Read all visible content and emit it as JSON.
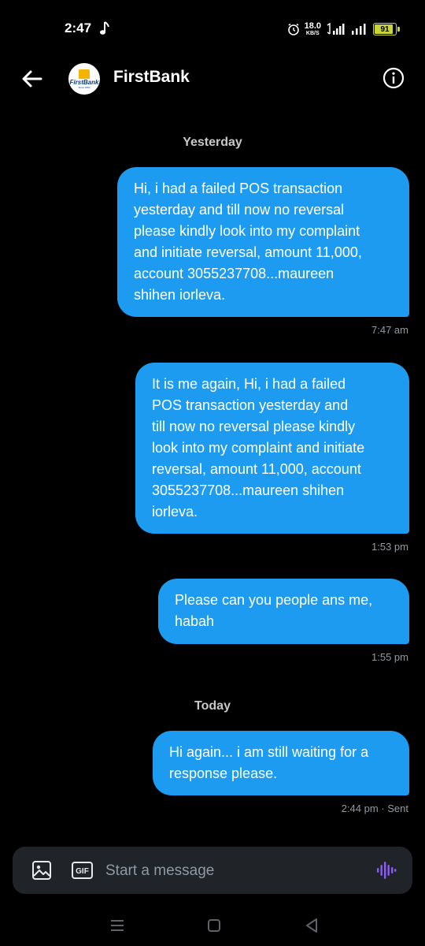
{
  "status_bar": {
    "time": "2:47",
    "network_speed": "18.0",
    "network_unit": "KB/S",
    "battery": "91",
    "battery_level": 0.91,
    "icons": [
      "music-note-icon",
      "alarm-icon",
      "hd-signal-icon",
      "signal-icon",
      "battery-icon"
    ]
  },
  "header": {
    "contact_name": "FirstBank",
    "avatar_text": "FirstBank",
    "avatar_since": "Since 1894",
    "back_icon": "arrow-left-icon",
    "info_icon": "info-icon"
  },
  "conversation": {
    "day_1": "Yesterday",
    "day_2": "Today",
    "messages": [
      {
        "text": "Hi, i had a failed POS transaction\nyesterday and till now no reversal\nplease kindly look into my complaint\nand initiate reversal, amount 11,000,\naccount 3055237708...maureen\nshihen iorleva.",
        "time": "7:47 am"
      },
      {
        "text": "It is me again, Hi, i had a failed\nPOS transaction yesterday and\ntill now no reversal please kindly\nlook into my complaint and initiate\nreversal, amount 11,000, account\n3055237708...maureen shihen\niorleva.",
        "time": "1:53 pm"
      },
      {
        "text": "Please can you people ans me,\nhabah",
        "time": "1:55 pm"
      },
      {
        "text": "Hi again... i am still waiting for a\nresponse please.",
        "time": "2:44 pm · Sent"
      }
    ]
  },
  "composer": {
    "placeholder": "Start a message",
    "gif_label": "GIF",
    "accent": "#8b5cf6"
  },
  "colors": {
    "bubble": "#1d9bf0",
    "background": "#000000",
    "meta_text": "#8f9aa3"
  }
}
